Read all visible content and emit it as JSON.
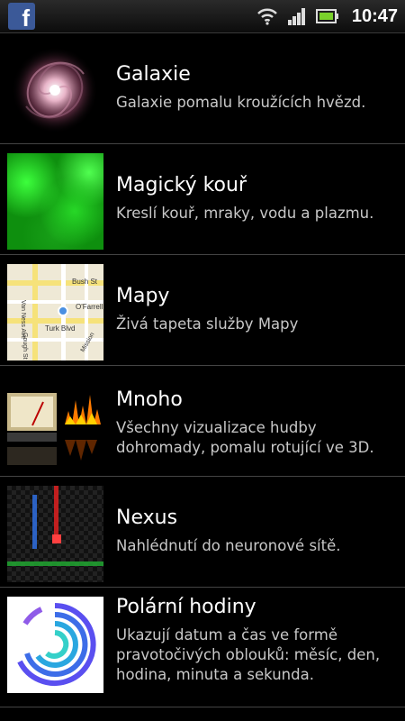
{
  "statusbar": {
    "app_icon": "facebook-icon",
    "app_icon_letter": "f",
    "wifi_icon": "wifi-icon",
    "signal_icon": "signal-icon",
    "battery_icon": "battery-icon",
    "time": "10:47"
  },
  "items": [
    {
      "title": "Galaxie",
      "desc": "Galaxie pomalu kroužících hvězd."
    },
    {
      "title": "Magický kouř",
      "desc": "Kreslí kouř, mraky, vodu a plazmu."
    },
    {
      "title": "Mapy",
      "desc": "Živá tapeta služby Mapy",
      "map_labels": [
        "Van Ness Ave",
        "Bush St",
        "O'Farrell",
        "Turk Blvd",
        "Gough St",
        "Mission"
      ]
    },
    {
      "title": "Mnoho",
      "desc": "Všechny vizualizace hudby dohromady, pomalu rotující ve 3D."
    },
    {
      "title": "Nexus",
      "desc": "Nahlédnutí do neuronové sítě."
    },
    {
      "title": "Polární hodiny",
      "desc": "Ukazují datum a čas ve formě pravotočivých oblouků: měsíc, den, hodina, minuta a sekunda."
    }
  ]
}
